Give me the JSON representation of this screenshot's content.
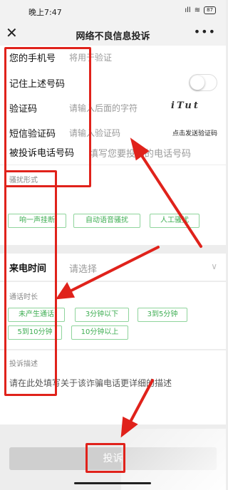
{
  "status_bar": {
    "time": "晚上7:47",
    "signal": "ıll",
    "wifi": "≋",
    "battery": "87"
  },
  "navbar": {
    "close": "✕",
    "title": "网络不良信息投诉",
    "more": "•••"
  },
  "form": {
    "phone_label": "您的手机号",
    "phone_placeholder": "将用于验证",
    "remember_label": "记住上述号码",
    "captcha_label": "验证码",
    "captcha_placeholder": "请输入后面的字符",
    "captcha_text": "iTut",
    "sms_label": "短信验证码",
    "sms_placeholder": "请输入验证码",
    "send_sms": "点击发送验证码",
    "reported_label": "被投诉电话号码",
    "reported_placeholder": "填写您要投诉的电话号码",
    "harass_title": "骚扰形式",
    "harass_options": [
      "响一声挂断",
      "自动语音骚扰",
      "人工骚扰"
    ],
    "call_time_label": "来电时间",
    "call_time_placeholder": "请选择",
    "chevron": "∨",
    "duration_title": "通话时长",
    "duration_options": [
      "未产生通话",
      "3分钟以下",
      "3到5分钟",
      "5到10分钟",
      "10分钟以上"
    ],
    "desc_title": "投诉描述",
    "desc_placeholder": "请在此处填写关于该诈骗电话更详细的描述",
    "submit": "投诉"
  },
  "colors": {
    "annotation": "#e0221b",
    "tag_green": "#3fae53"
  }
}
